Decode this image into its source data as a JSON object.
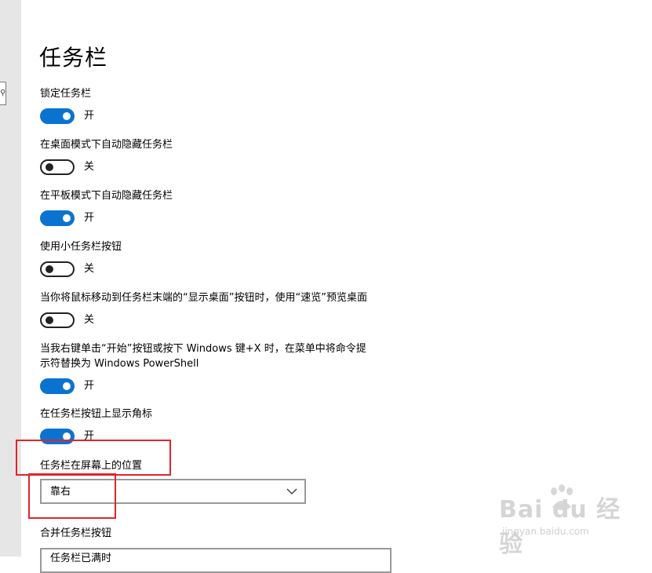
{
  "page": {
    "title": "任务栏"
  },
  "settings": [
    {
      "label": "锁定任务栏",
      "state": "开",
      "on": true
    },
    {
      "label": "在桌面模式下自动隐藏任务栏",
      "state": "关",
      "on": false
    },
    {
      "label": "在平板模式下自动隐藏任务栏",
      "state": "开",
      "on": true
    },
    {
      "label": "使用小任务栏按钮",
      "state": "关",
      "on": false
    },
    {
      "label": "当你将鼠标移动到任务栏末端的“显示桌面”按钮时，使用“速览”预览桌面",
      "state": "关",
      "on": false
    },
    {
      "label_line1": "当我右键单击“开始”按钮或按下 Windows 键+X 时，在菜单中将命令提",
      "label_line2": "示符替换为 Windows PowerShell",
      "state": "开",
      "on": true
    },
    {
      "label": "在任务栏按钮上显示角标",
      "state": "开",
      "on": true
    }
  ],
  "position": {
    "label": "任务栏在屏幕上的位置",
    "value": "靠右"
  },
  "combine": {
    "label": "合并任务栏按钮",
    "value": "任务栏已满时"
  },
  "watermark": {
    "brand": "Bai du 经验",
    "url": "jingyan.baidu.com"
  },
  "colors": {
    "accent": "#0a73d1",
    "highlight": "#e0242c",
    "rail": "#e6e6e6"
  },
  "icons": {
    "dropdown": "chevron-down-icon"
  }
}
